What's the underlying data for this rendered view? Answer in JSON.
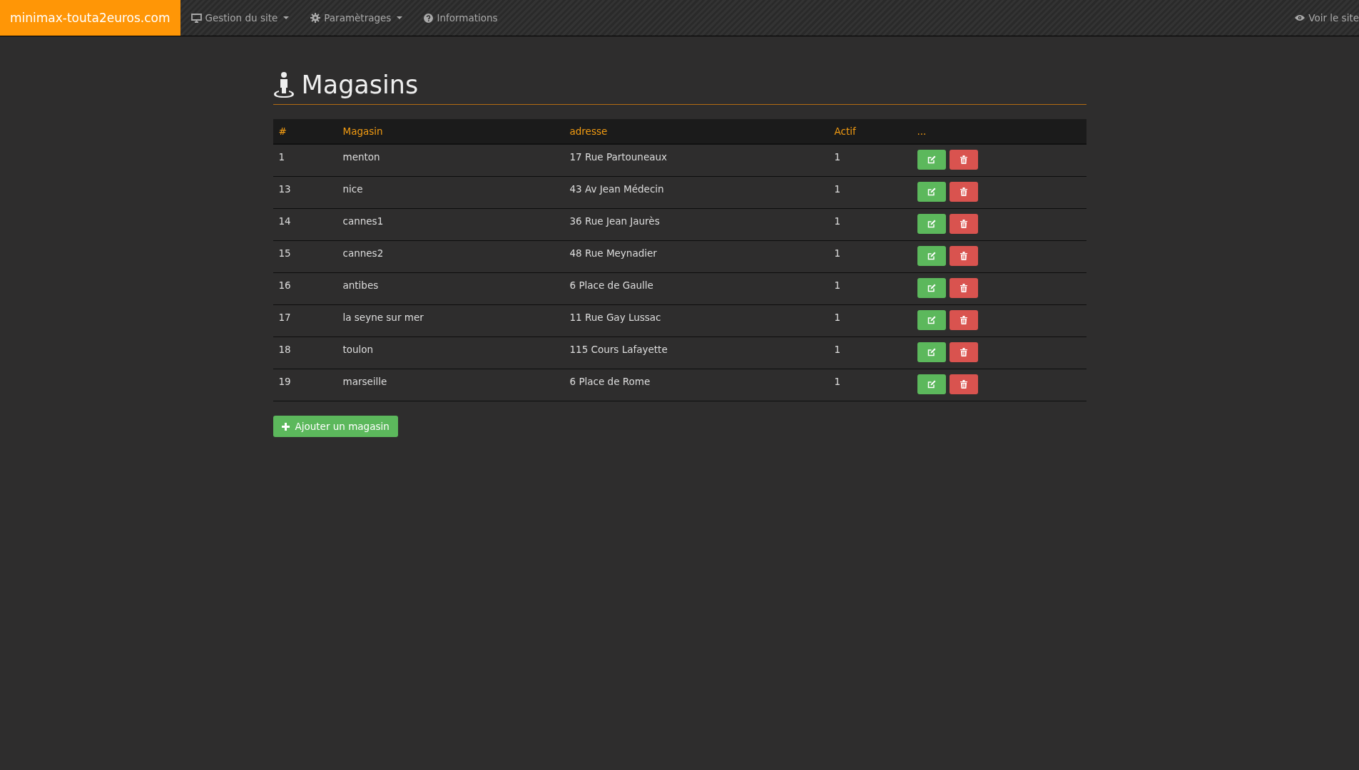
{
  "navbar": {
    "brand": "minimax-touta2euros.com",
    "menus": [
      {
        "kind": "monitor",
        "label": "Gestion du site",
        "dropdown": true
      },
      {
        "kind": "gear",
        "label": "Paramètrages",
        "dropdown": true
      },
      {
        "kind": "question",
        "label": "Informations",
        "dropdown": false
      }
    ],
    "right_link": "Voir le site"
  },
  "page": {
    "title": "Magasins"
  },
  "table": {
    "columns": [
      "#",
      "Magasin",
      "adresse",
      "Actif",
      "..."
    ],
    "rows": [
      {
        "id": "1",
        "name": "menton",
        "address": "17 Rue Partouneaux",
        "active": "1"
      },
      {
        "id": "13",
        "name": "nice",
        "address": "43 Av Jean Médecin",
        "active": "1"
      },
      {
        "id": "14",
        "name": "cannes1",
        "address": "36 Rue Jean Jaurès",
        "active": "1"
      },
      {
        "id": "15",
        "name": "cannes2",
        "address": "48 Rue Meynadier",
        "active": "1"
      },
      {
        "id": "16",
        "name": "antibes",
        "address": "6 Place de Gaulle",
        "active": "1"
      },
      {
        "id": "17",
        "name": "la seyne sur mer",
        "address": "11 Rue Gay Lussac",
        "active": "1"
      },
      {
        "id": "18",
        "name": "toulon",
        "address": "115 Cours Lafayette",
        "active": "1"
      },
      {
        "id": "19",
        "name": "marseille",
        "address": "6 Place de Rome",
        "active": "1"
      }
    ]
  },
  "add_button": "Ajouter un magasin"
}
